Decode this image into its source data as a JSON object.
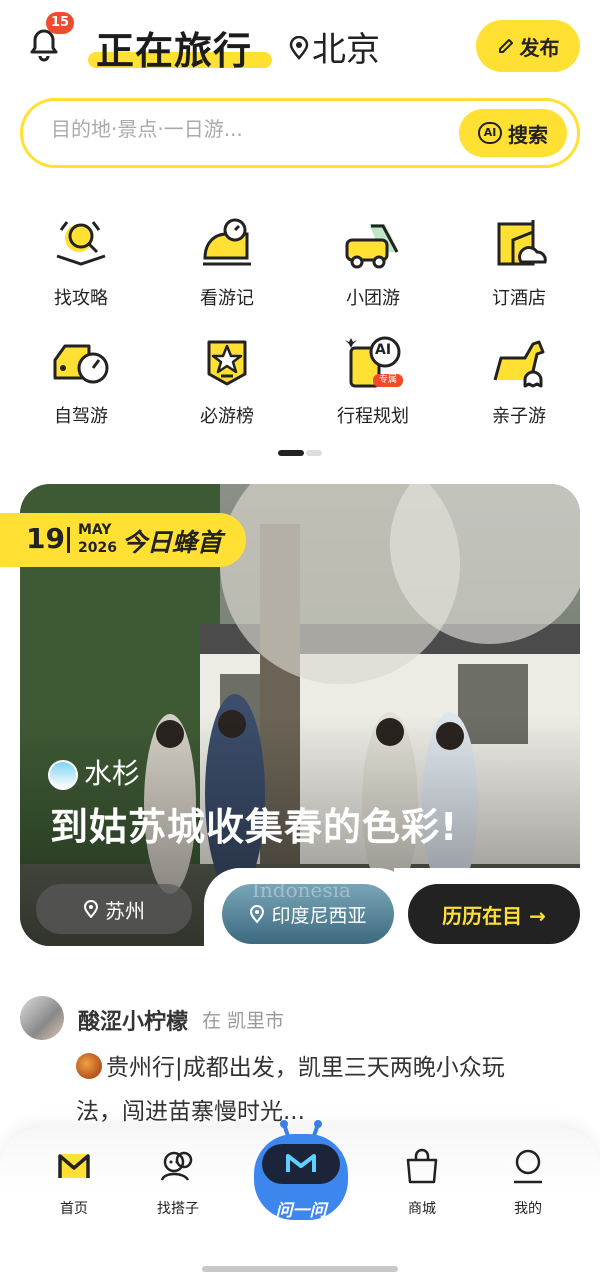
{
  "header": {
    "notification_count": "15",
    "title": "正在旅行",
    "city": "北京",
    "publish_label": "发布"
  },
  "search": {
    "placeholder": "目的地·景点·一日游...",
    "button_ai": "AI",
    "button_label": "搜索"
  },
  "shortcuts": [
    {
      "label": "找攻略",
      "icon": "guide-icon"
    },
    {
      "label": "看游记",
      "icon": "travelogue-icon"
    },
    {
      "label": "小团游",
      "icon": "group-tour-icon"
    },
    {
      "label": "订酒店",
      "icon": "hotel-icon"
    },
    {
      "label": "自驾游",
      "icon": "self-drive-icon"
    },
    {
      "label": "必游榜",
      "icon": "ranking-icon"
    },
    {
      "label": "行程规划",
      "icon": "trip-planner-icon",
      "badge": "专属",
      "badge_ai": "AI"
    },
    {
      "label": "亲子游",
      "icon": "family-trip-icon"
    }
  ],
  "hero": {
    "day": "19",
    "month": "MAY",
    "year": "2026",
    "tag_label": "今日蜂首",
    "author": "水杉",
    "title": "到姑苏城收集春的色彩!",
    "chip_location": "苏州",
    "chip_destination": "印度尼西亚",
    "chip_destination_overlay": "Indonesia",
    "chip_history": "历历在目 →"
  },
  "feed": {
    "user": "酸涩小柠檬",
    "location_prefix": "在 凯里市",
    "text": "贵州行|成都出发，凯里三天两晚小众玩法，闯进苗寨慢时光..."
  },
  "nav": {
    "home": "首页",
    "partner": "找搭子",
    "ask": "问一问",
    "mall": "商城",
    "mine": "我的"
  },
  "colors": {
    "accent": "#ffe033",
    "badge_red": "#f04b2a",
    "dark": "#222222"
  }
}
